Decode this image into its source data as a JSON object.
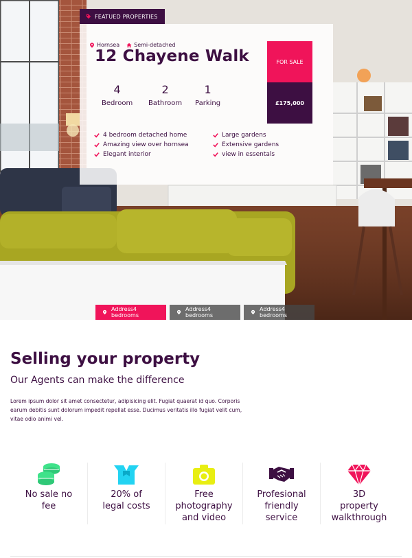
{
  "hero": {
    "featured_label": "FEATUED PROPERTIES",
    "location": "Hornsea",
    "property_type": "Semi-detached",
    "title": "12 Chayene Walk",
    "stats": [
      {
        "value": "4",
        "label": "Bedroom"
      },
      {
        "value": "2",
        "label": "Bathroom"
      },
      {
        "value": "1",
        "label": "Parking"
      }
    ],
    "features": [
      "4 bedroom detached home",
      "Amazing view over hornsea",
      "Elegant interior",
      "Large gardens",
      "Extensive gardens",
      "view in essentals"
    ],
    "status": "FOR SALE",
    "price": "£175,000",
    "addresses": [
      "Address4 bedrooms",
      "Address4 bedrooms",
      "Address4 bedrooms"
    ]
  },
  "selling": {
    "title": "Selling your property",
    "subtitle": "Our Agents can make the difference",
    "body": "Lorem ipsum dolor sit amet consectetur, adipisicing elit. Fugiat quaerat id quo. Corporis earum debitis sunt dolorum impedit repellat esse. Ducimus veritatis illo fugiat velit cum, vitae odio animi vel."
  },
  "services": [
    {
      "line1": "No sale no",
      "line2": "fee",
      "line3": "",
      "icon": "coins-icon",
      "color": "#3fe28a"
    },
    {
      "line1": "20% of",
      "line2": "legal costs",
      "line3": "",
      "icon": "open-box-icon",
      "color": "#22d3f2"
    },
    {
      "line1": "Free",
      "line2": "photography",
      "line3": "and video",
      "icon": "camera-icon",
      "color": "#e8ee12"
    },
    {
      "line1": "Profesional",
      "line2": "friendly",
      "line3": "service",
      "icon": "handshake-icon",
      "color": "#3d0f42"
    },
    {
      "line1": "3D",
      "line2": "property",
      "line3": "walkthrough",
      "icon": "diamond-icon",
      "color": "#f0145a"
    }
  ],
  "colors": {
    "primary": "#3d0f42",
    "accent": "#f0145a"
  }
}
